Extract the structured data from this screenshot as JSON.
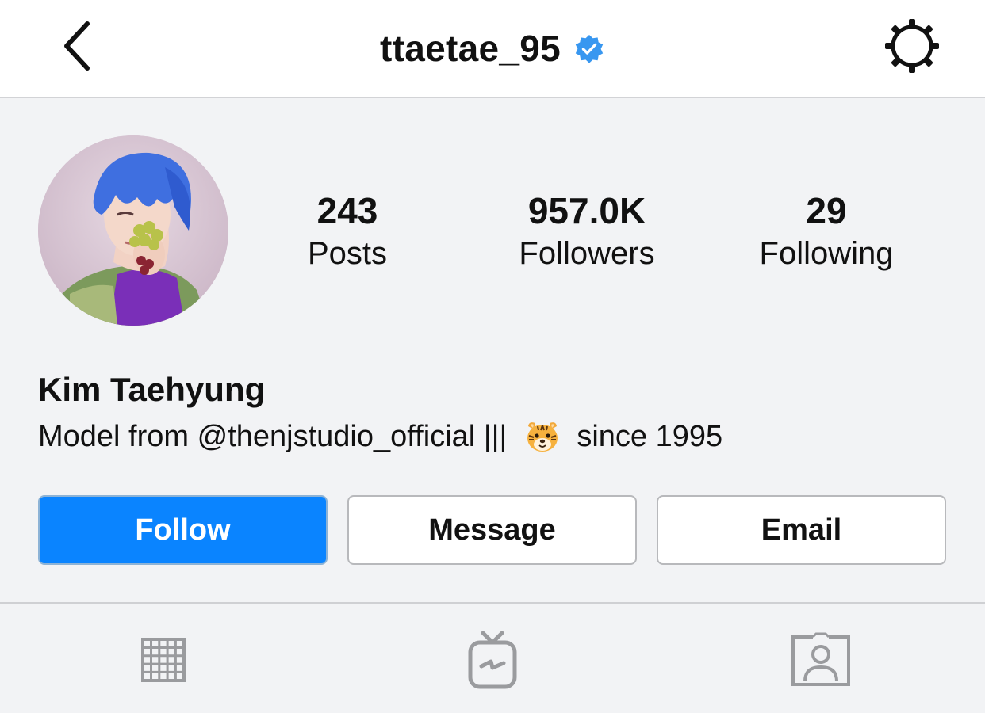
{
  "header": {
    "username": "ttaetae_95",
    "back_icon": "chevron-left-icon",
    "settings_icon": "gear-icon",
    "verified_icon": "verified-badge-icon"
  },
  "profile": {
    "avatar_icon": "profile-photo",
    "stats": [
      {
        "value": "243",
        "label": "Posts"
      },
      {
        "value": "957.0K",
        "label": "Followers"
      },
      {
        "value": "29",
        "label": "Following"
      }
    ],
    "display_name": "Kim Taehyung",
    "bio_before": "Model from @thenjstudio_official |||",
    "bio_emoji": "tiger-face-emoji",
    "bio_after": "since 1995"
  },
  "actions": {
    "follow_label": "Follow",
    "message_label": "Message",
    "email_label": "Email"
  },
  "tabs": [
    {
      "icon": "grid-icon"
    },
    {
      "icon": "igtv-icon"
    },
    {
      "icon": "tagged-photos-icon"
    }
  ],
  "colors": {
    "accent": "#0a84ff",
    "verified": "#3897f0",
    "background": "#f2f3f5",
    "tab_icon": "#9a9b9e"
  }
}
